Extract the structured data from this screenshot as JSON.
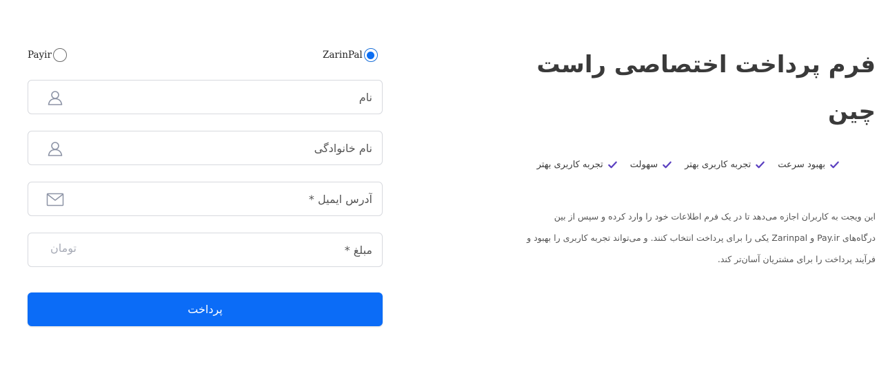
{
  "colors": {
    "accent": "#0b6cf7",
    "check": "#5a3fc0",
    "border": "#d7d9de"
  },
  "info": {
    "title": "فرم پرداخت اختصاصی راست چین",
    "features": [
      {
        "label": "بهبود سرعت",
        "icon": "check-icon"
      },
      {
        "label": "تجربه کاربری بهتر",
        "icon": "check-icon"
      },
      {
        "label": "سهولت",
        "icon": "check-icon"
      },
      {
        "label": "تجربه کاربری بهتر",
        "icon": "check-icon"
      }
    ],
    "description_line1": "این ویجت به کاربران اجازه می‌دهد تا در یک فرم اطلاعات خود را وارد کرده و سپس از بین",
    "description_line2": "درگاه‌های Pay.ir و Zarinpal یکی را برای پرداخت انتخاب کنند. و می‌تواند تجربه کاربری را بهبود و",
    "description_line3": "فرآیند پرداخت را برای مشتریان آسان‌تر کند."
  },
  "form": {
    "gateways": [
      {
        "label": "ZarinPal",
        "selected": true
      },
      {
        "label": "Payir",
        "selected": false
      }
    ],
    "fields": {
      "first_name": {
        "placeholder": "نام",
        "icon": "user-icon"
      },
      "last_name": {
        "placeholder": "نام خانوادگی",
        "icon": "user-icon"
      },
      "email": {
        "placeholder": "آدرس ایمیل *",
        "icon": "envelope-icon"
      },
      "amount": {
        "placeholder": "مبلغ *",
        "unit": "تومان"
      }
    },
    "submit_label": "پرداخت"
  }
}
